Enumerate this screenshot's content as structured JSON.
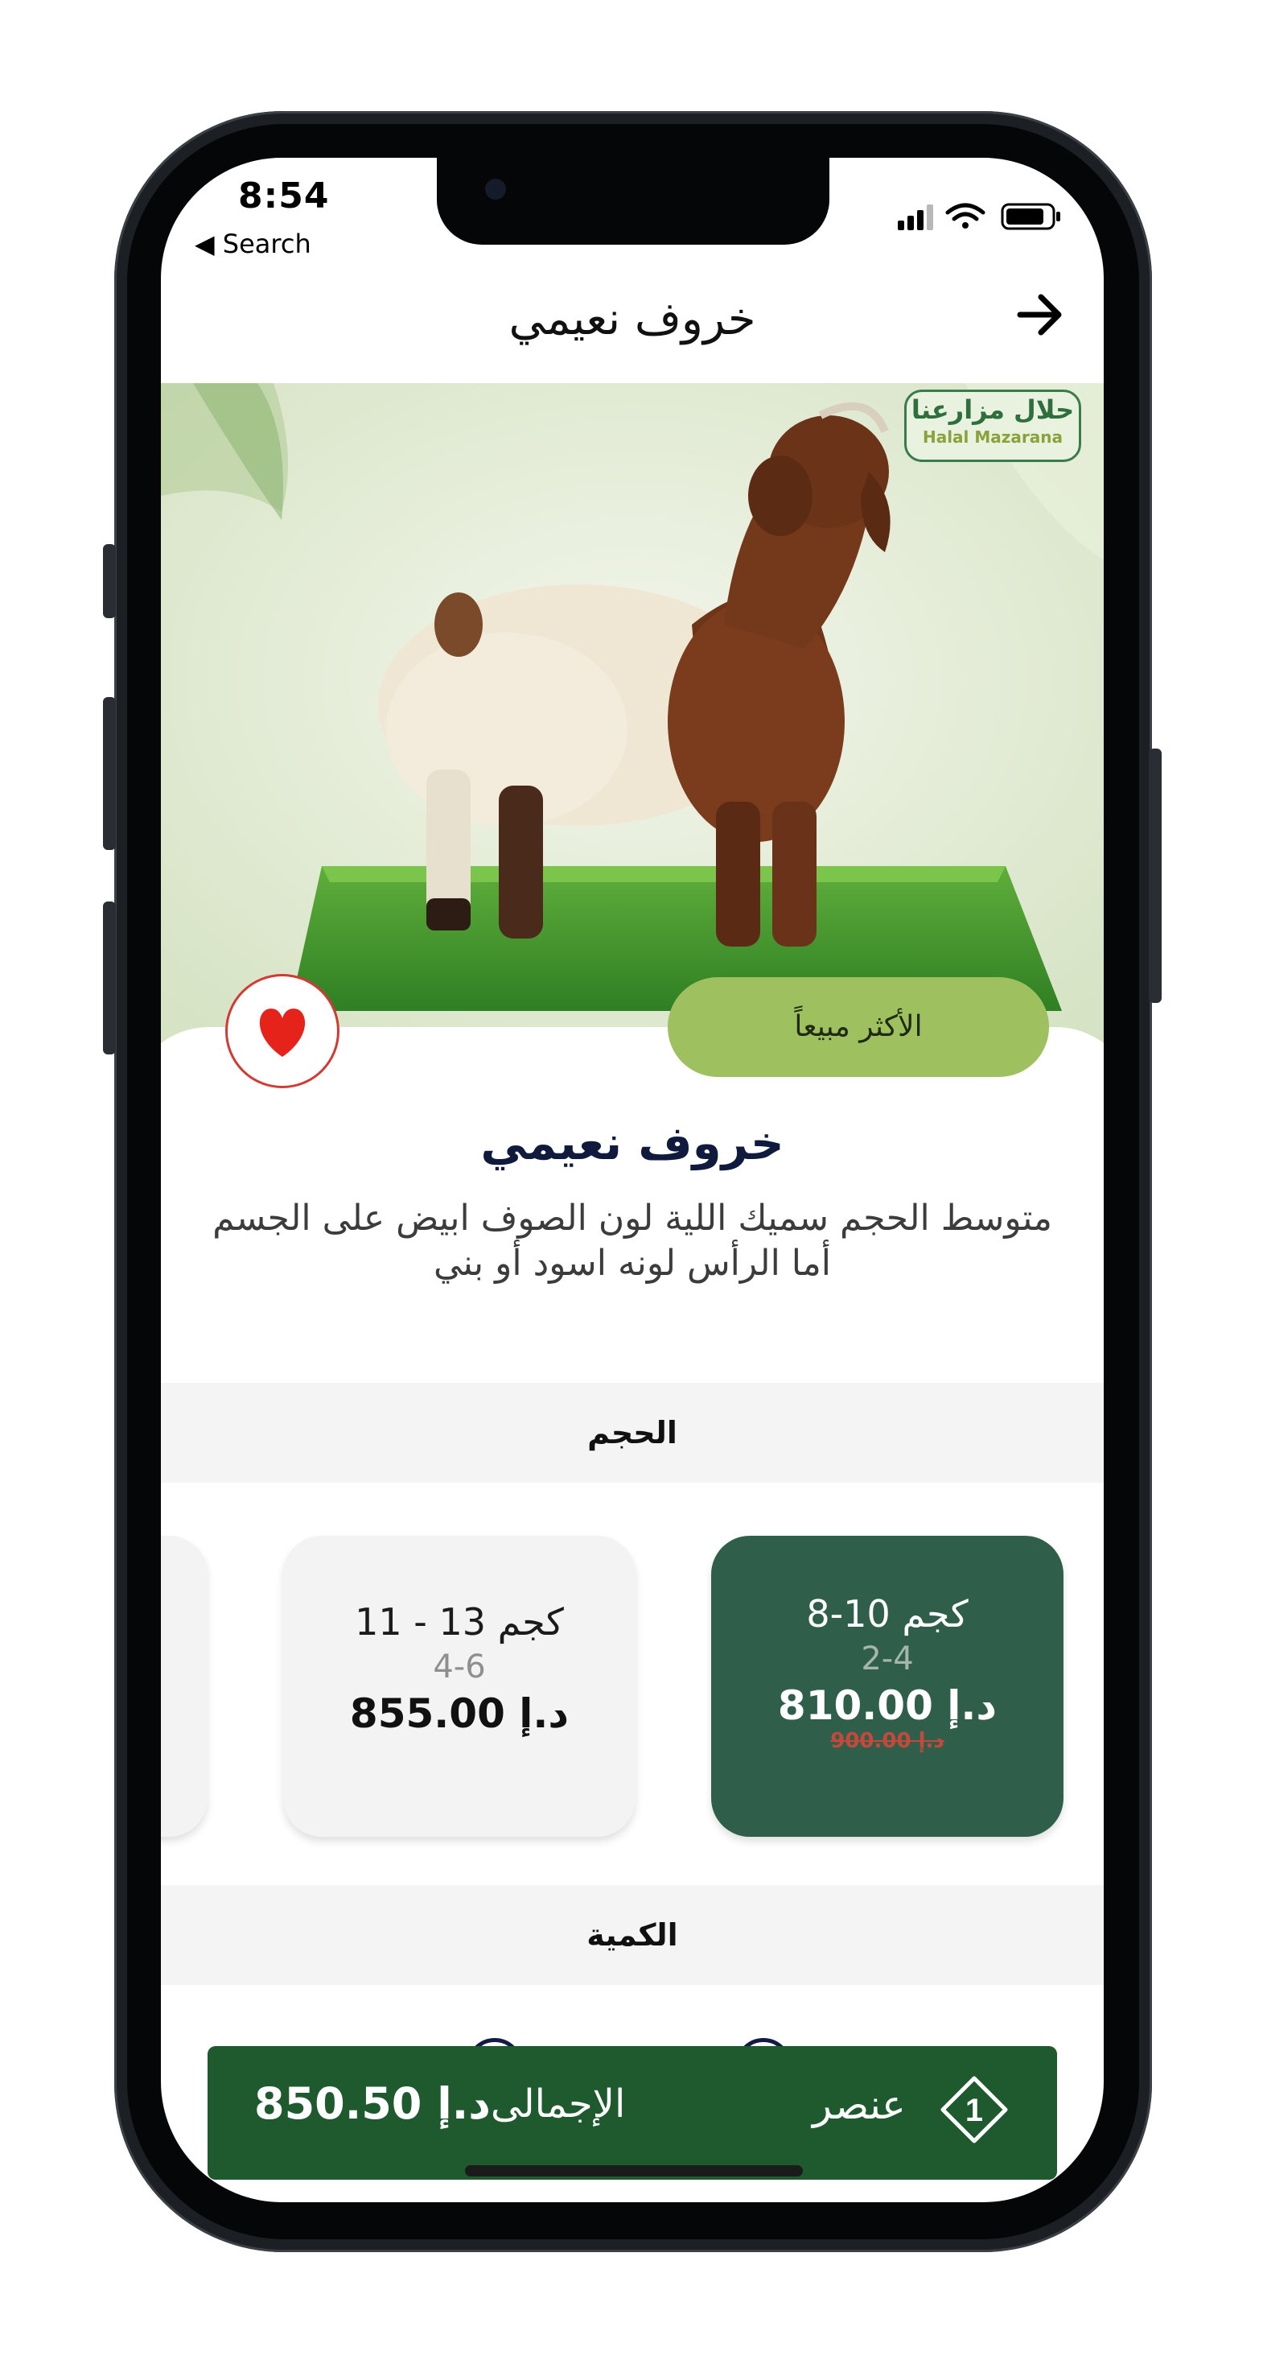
{
  "status": {
    "time": "8:54",
    "back_label": "◀ Search"
  },
  "nav": {
    "title": "خروف نعيمي",
    "back_icon": "arrow-right-icon"
  },
  "hero": {
    "halal_ar": "حلال مزارعنا",
    "halal_en": "Halal Mazarana",
    "best_seller": "الأكثر مبيعاً",
    "favorite_icon": "heart-icon"
  },
  "product": {
    "title": "خروف نعيمي",
    "description": "متوسط الحجم سميك اللية لون الصوف ابيض على الجسم أما الرأس لونه اسود أو بني"
  },
  "size_section": {
    "label": "الحجم",
    "options": [
      {
        "range": "8-10 كجم",
        "count": "2-4",
        "price": "810.00 د.إ",
        "old_price": "900.00 د.إ",
        "selected": true
      },
      {
        "range": "11 - 13 كجم",
        "count": "4-6",
        "price": "855.00 د.إ",
        "old_price": "",
        "selected": false
      }
    ]
  },
  "quantity_section": {
    "label": "الكمية"
  },
  "cart": {
    "count": "1",
    "items_label": "عنصر",
    "total_label": "الإجمالى",
    "total_value": "850.50 د.إ"
  },
  "colors": {
    "brand_green": "#1e5a2d",
    "selected_card": "#2f5f4a",
    "best_seller_pill": "#9ec05e",
    "favorite_red": "#e5231b"
  }
}
